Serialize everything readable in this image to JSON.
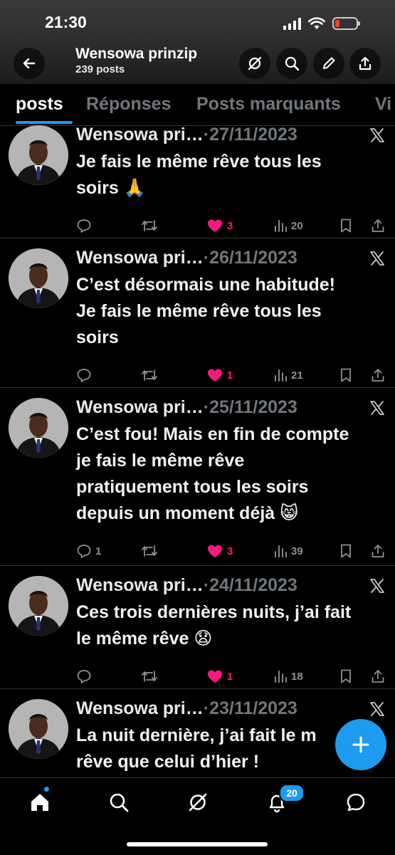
{
  "status_bar": {
    "time": "21:30"
  },
  "profile": {
    "name": "Wensowa prinzip",
    "post_count": "239 posts"
  },
  "tabs": [
    {
      "label": "posts",
      "active": true
    },
    {
      "label": "Réponses",
      "active": false
    },
    {
      "label": "Posts marquants",
      "active": false
    },
    {
      "label": "Vi",
      "active": false
    }
  ],
  "posts": [
    {
      "author": "Wensowa pri…",
      "date": "·27/11/2023",
      "lines": [
        "Je fais le même rêve tous les",
        "soirs 🙏"
      ],
      "replies": "",
      "reposts": "",
      "likes": "3",
      "views": "20"
    },
    {
      "author": "Wensowa pri…",
      "date": "·26/11/2023",
      "lines": [
        "C’est désormais une habitude!",
        "Je fais le même rêve tous les",
        "soirs"
      ],
      "replies": "",
      "reposts": "",
      "likes": "1",
      "views": "21"
    },
    {
      "author": "Wensowa pri…",
      "date": "·25/11/2023",
      "lines": [
        "C’est fou! Mais en fin de compte",
        "je fais le même rêve",
        "pratiquement tous les soirs",
        "depuis un moment déjà 😸"
      ],
      "replies": "1",
      "reposts": "",
      "likes": "3",
      "views": "39"
    },
    {
      "author": "Wensowa pri…",
      "date": "·24/11/2023",
      "lines": [
        "Ces trois dernières nuits, j’ai fait",
        "le même rêve 😧"
      ],
      "replies": "",
      "reposts": "",
      "likes": "1",
      "views": "18"
    },
    {
      "author": "Wensowa pri…",
      "date": "·23/11/2023",
      "lines": [
        "La nuit dernière, j’ai fait le m",
        "rêve que celui d’hier !"
      ],
      "replies": "",
      "reposts": "",
      "likes": "",
      "views": ""
    }
  ],
  "bottom_nav": {
    "notifications_badge": "20"
  },
  "colors": {
    "accent": "#1d9bf0",
    "like": "#f91880",
    "muted": "#71767b"
  },
  "icons": [
    "back-arrow-icon",
    "grok-icon",
    "search-icon",
    "pencil-icon",
    "share-icon",
    "x-logo-icon",
    "reply-icon",
    "repost-icon",
    "heart-icon",
    "views-icon",
    "bookmark-icon",
    "plus-icon",
    "home-icon",
    "bell-icon",
    "messages-icon"
  ]
}
